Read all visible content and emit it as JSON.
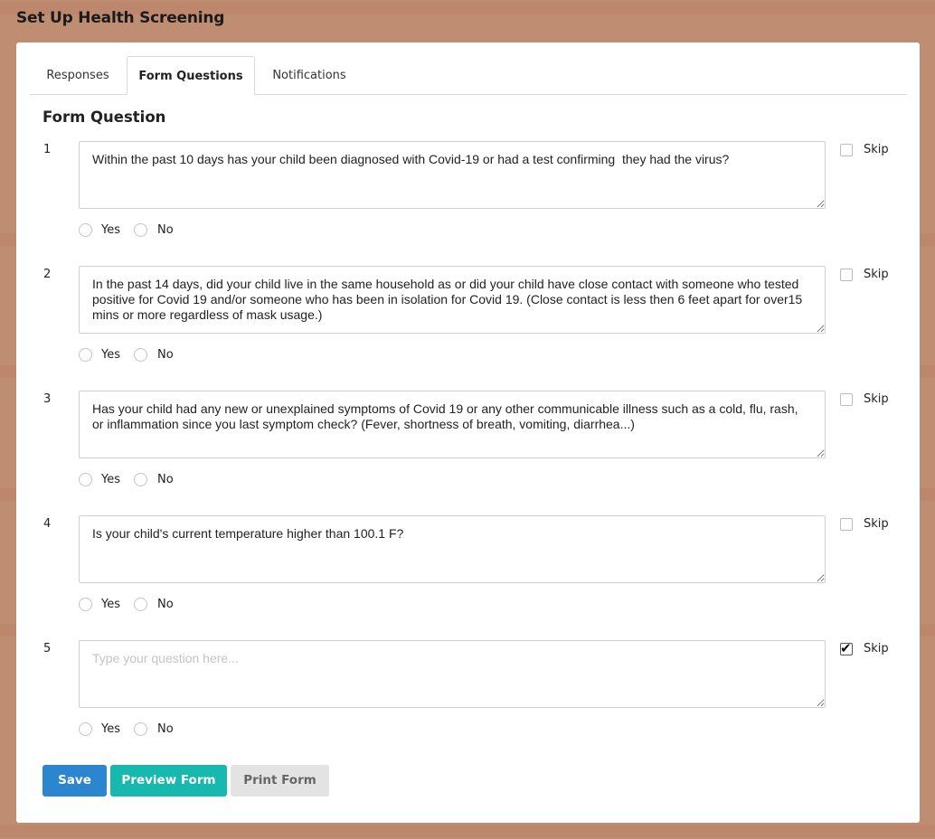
{
  "page": {
    "title": "Set Up Health Screening"
  },
  "tabs": [
    {
      "label": "Responses",
      "active": false
    },
    {
      "label": "Form Questions",
      "active": true
    },
    {
      "label": "Notifications",
      "active": false
    }
  ],
  "form": {
    "section_title": "Form Question",
    "placeholder": "Type your question here...",
    "yes_label": "Yes",
    "no_label": "No",
    "skip_label": "Skip",
    "questions": [
      {
        "number": "1",
        "text": "Within the past 10 days has your child been diagnosed with Covid-19 or had a test confirming  they had the virus?",
        "skip": false
      },
      {
        "number": "2",
        "text": "In the past 14 days, did your child live in the same household as or did your child have close contact with someone who tested positive for Covid 19 and/or someone who has been in isolation for Covid 19. (Close contact is less then 6 feet apart for over15 mins or more regardless of mask usage.)",
        "skip": false
      },
      {
        "number": "3",
        "text": "Has your child had any new or unexplained symptoms of Covid 19 or any other communicable illness such as a cold, flu, rash, or inflammation since you last symptom check? (Fever, shortness of breath, vomiting, diarrhea...)",
        "skip": false
      },
      {
        "number": "4",
        "text": "Is your child's current temperature higher than 100.1 F?",
        "skip": false
      },
      {
        "number": "5",
        "text": "",
        "skip": true
      }
    ]
  },
  "buttons": {
    "save": "Save",
    "preview": "Preview Form",
    "print": "Print Form"
  },
  "colors": {
    "background": "#bf8d72",
    "save": "#2b86cf",
    "preview": "#17b8ad",
    "print": "#e3e3e3"
  }
}
